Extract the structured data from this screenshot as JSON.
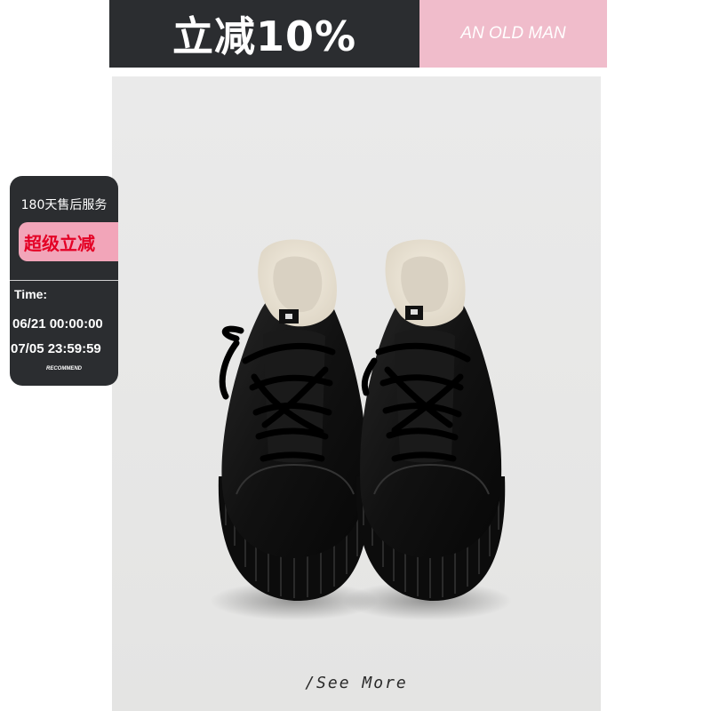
{
  "banner": {
    "discount": "立减10%",
    "brand": "AN OLD MAN"
  },
  "promo": {
    "service": "180天售后服务",
    "tag": "超级立减",
    "time_label": "Time:",
    "start": "06/21 00:00:00",
    "end": "07/05 23:59:59",
    "recommend": "RECOMMEND"
  },
  "footer": {
    "see_more": "/See More"
  },
  "colors": {
    "banner_dark": "#2b2d30",
    "banner_pink": "#f0bccb",
    "tag_pink": "#f2a5b9",
    "tag_red": "#e40025"
  }
}
